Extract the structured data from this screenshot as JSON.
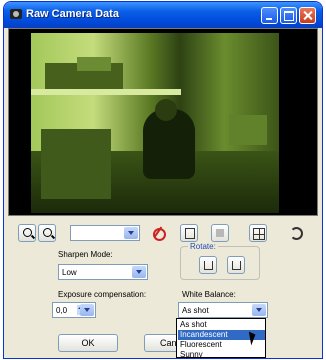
{
  "window": {
    "title": "Raw Camera Data"
  },
  "controls": {
    "sharpen_label": "Sharpen Mode:",
    "sharpen_value": "Low",
    "rotate_label": "Rotate:",
    "exposure_label": "Exposure compensation:",
    "exposure_value": "0,0",
    "white_balance_label": "White Balance:",
    "white_balance_value": "As shot",
    "white_balance_options": [
      "As shot",
      "Incandescent",
      "Fluorescent",
      "Sunny"
    ],
    "white_balance_highlighted": "Incandescent"
  },
  "buttons": {
    "ok": "OK",
    "cancel": "Cancel"
  }
}
